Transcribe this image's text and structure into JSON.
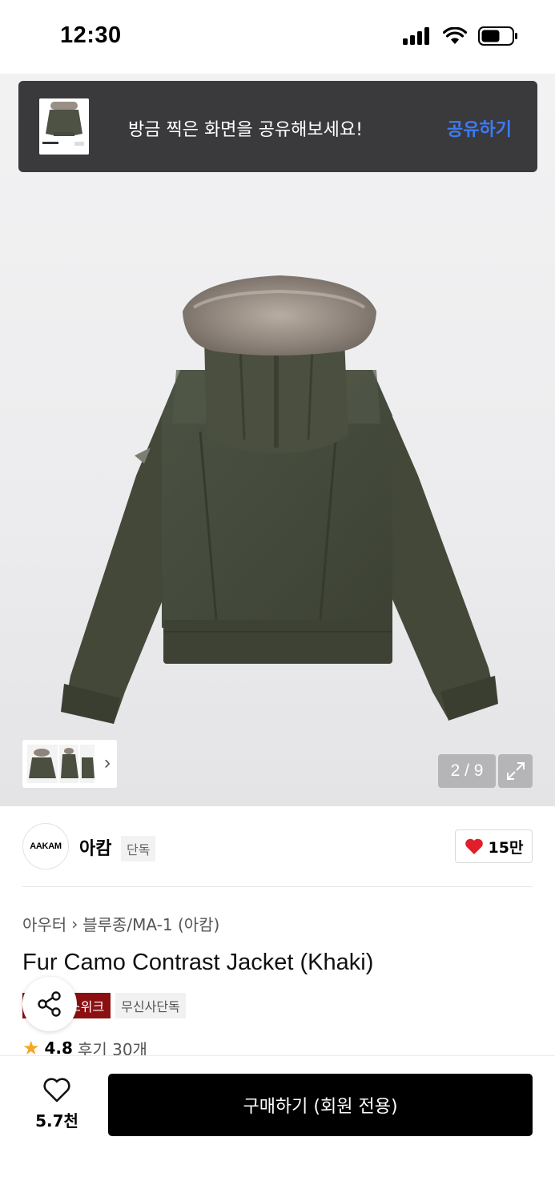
{
  "status_bar": {
    "time": "12:30"
  },
  "share_toast": {
    "message": "방금 찍은 화면을 공유해보세요!",
    "action_label": "공유하기"
  },
  "gallery": {
    "counter": "2 / 9"
  },
  "brand": {
    "logo_text": "AAKAM",
    "name": "아캄",
    "tag": "단독"
  },
  "like": {
    "count": "15만"
  },
  "breadcrumb": {
    "category": "아우터",
    "subcategory": "블루종/MA-1 (아캄)"
  },
  "product": {
    "title": "Fur Camo Contrast Jacket (Khaki)",
    "badge_event": "스위크",
    "badge_exclusive": "무신사단독",
    "rating": "4.8",
    "reviews": "후기 30개"
  },
  "bottom_bar": {
    "wish_count": "5.7천",
    "buy_label": "구매하기 (회원 전용)"
  },
  "colors": {
    "accent_blue": "#3d7bf7",
    "heart_red": "#e01f2a",
    "badge_red": "#8c0f12",
    "star": "#f5a623"
  }
}
